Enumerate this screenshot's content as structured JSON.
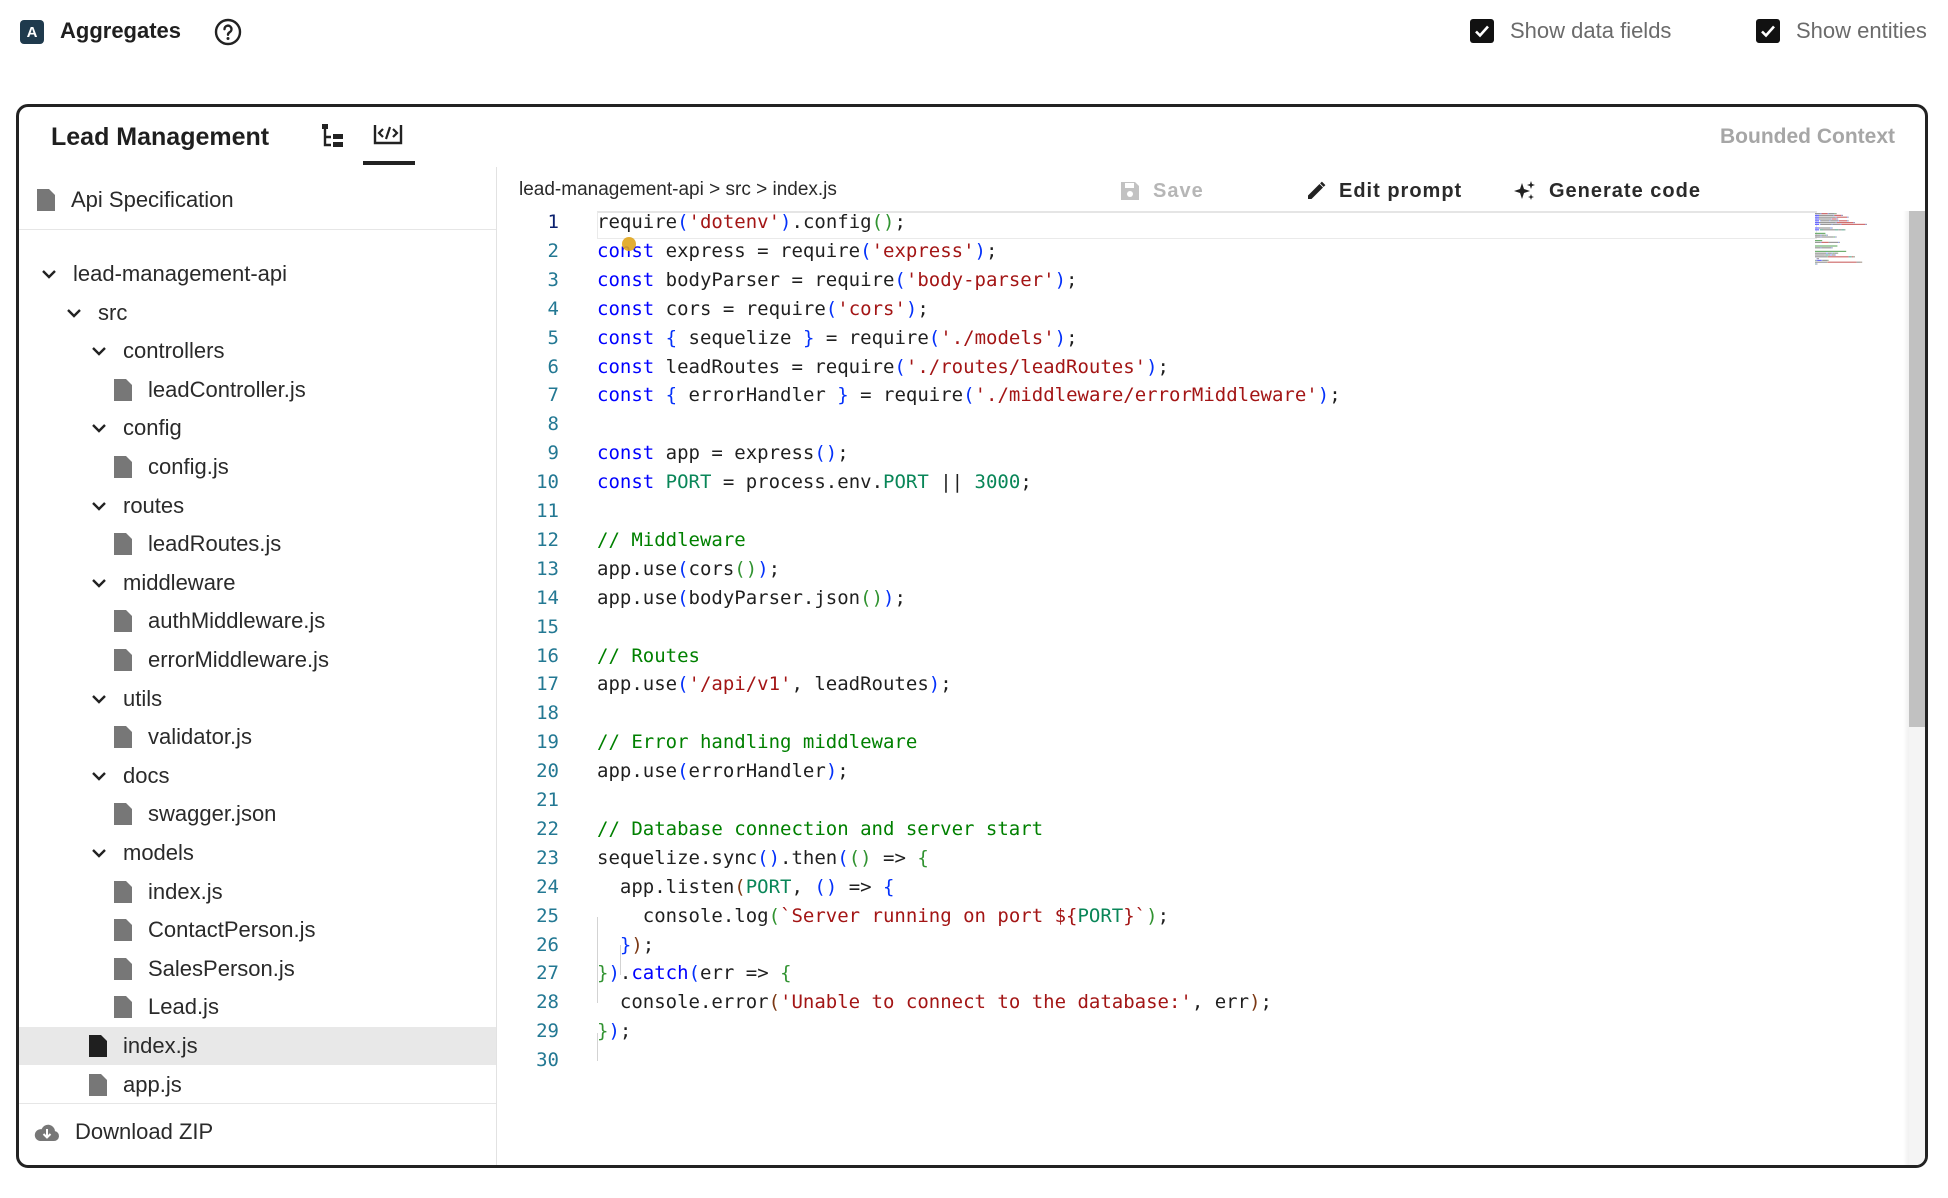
{
  "app": {
    "title": "Aggregates",
    "logo_letter": "A"
  },
  "toggles": [
    {
      "label": "Show data fields",
      "checked": true
    },
    {
      "label": "Show entities",
      "checked": true
    }
  ],
  "panel": {
    "title": "Lead Management",
    "context_label": "Bounded Context"
  },
  "sidebar": {
    "api_spec": "Api Specification",
    "tree": [
      {
        "label": "lead-management-api",
        "type": "folder"
      },
      {
        "label": "src",
        "type": "folder"
      },
      {
        "label": "controllers",
        "type": "folder"
      },
      {
        "label": "leadController.js",
        "type": "file"
      },
      {
        "label": "config",
        "type": "folder"
      },
      {
        "label": "config.js",
        "type": "file"
      },
      {
        "label": "routes",
        "type": "folder"
      },
      {
        "label": "leadRoutes.js",
        "type": "file"
      },
      {
        "label": "middleware",
        "type": "folder"
      },
      {
        "label": "authMiddleware.js",
        "type": "file"
      },
      {
        "label": "errorMiddleware.js",
        "type": "file"
      },
      {
        "label": "utils",
        "type": "folder"
      },
      {
        "label": "validator.js",
        "type": "file"
      },
      {
        "label": "docs",
        "type": "folder"
      },
      {
        "label": "swagger.json",
        "type": "file"
      },
      {
        "label": "models",
        "type": "folder"
      },
      {
        "label": "index.js",
        "type": "file"
      },
      {
        "label": "ContactPerson.js",
        "type": "file"
      },
      {
        "label": "SalesPerson.js",
        "type": "file"
      },
      {
        "label": "Lead.js",
        "type": "file"
      },
      {
        "label": "index.js",
        "type": "file",
        "selected": true
      },
      {
        "label": "app.js",
        "type": "file"
      }
    ],
    "download": "Download ZIP"
  },
  "editor": {
    "breadcrumb": "lead-management-api > src > index.js",
    "save": "Save",
    "edit_prompt": "Edit prompt",
    "generate_code": "Generate code",
    "active_line": 1,
    "lines": [
      [
        [
          "tok",
          "require"
        ],
        [
          "br1",
          "("
        ],
        [
          "str",
          "'dotenv'"
        ],
        [
          "br1",
          ")"
        ],
        [
          "tok",
          ".config"
        ],
        [
          "br2",
          "()"
        ],
        [
          "tok",
          ";"
        ]
      ],
      [
        [
          "kw",
          "const"
        ],
        [
          "tok",
          " express = require"
        ],
        [
          "br1",
          "("
        ],
        [
          "str",
          "'express'"
        ],
        [
          "br1",
          ")"
        ],
        [
          "tok",
          ";"
        ]
      ],
      [
        [
          "kw",
          "const"
        ],
        [
          "tok",
          " bodyParser = require"
        ],
        [
          "br1",
          "("
        ],
        [
          "str",
          "'body-parser'"
        ],
        [
          "br1",
          ")"
        ],
        [
          "tok",
          ";"
        ]
      ],
      [
        [
          "kw",
          "const"
        ],
        [
          "tok",
          " cors = require"
        ],
        [
          "br1",
          "("
        ],
        [
          "str",
          "'cors'"
        ],
        [
          "br1",
          ")"
        ],
        [
          "tok",
          ";"
        ]
      ],
      [
        [
          "kw",
          "const"
        ],
        [
          "tok",
          " "
        ],
        [
          "br1",
          "{"
        ],
        [
          "tok",
          " sequelize "
        ],
        [
          "br1",
          "}"
        ],
        [
          "tok",
          " = require"
        ],
        [
          "br1",
          "("
        ],
        [
          "str",
          "'./models'"
        ],
        [
          "br1",
          ")"
        ],
        [
          "tok",
          ";"
        ]
      ],
      [
        [
          "kw",
          "const"
        ],
        [
          "tok",
          " leadRoutes = require"
        ],
        [
          "br1",
          "("
        ],
        [
          "str",
          "'./routes/leadRoutes'"
        ],
        [
          "br1",
          ")"
        ],
        [
          "tok",
          ";"
        ]
      ],
      [
        [
          "kw",
          "const"
        ],
        [
          "tok",
          " "
        ],
        [
          "br1",
          "{"
        ],
        [
          "tok",
          " errorHandler "
        ],
        [
          "br1",
          "}"
        ],
        [
          "tok",
          " = require"
        ],
        [
          "br1",
          "("
        ],
        [
          "str",
          "'./middleware/errorMiddleware'"
        ],
        [
          "br1",
          ")"
        ],
        [
          "tok",
          ";"
        ]
      ],
      [],
      [
        [
          "kw",
          "const"
        ],
        [
          "tok",
          " app = express"
        ],
        [
          "br1",
          "()"
        ],
        [
          "tok",
          ";"
        ]
      ],
      [
        [
          "kw",
          "const"
        ],
        [
          "tok",
          " "
        ],
        [
          "num",
          "PORT"
        ],
        [
          "tok",
          " = process.env."
        ],
        [
          "num",
          "PORT"
        ],
        [
          "tok",
          " || "
        ],
        [
          "num",
          "3000"
        ],
        [
          "tok",
          ";"
        ]
      ],
      [],
      [
        [
          "cm",
          "// Middleware"
        ]
      ],
      [
        [
          "tok",
          "app.use"
        ],
        [
          "br1",
          "("
        ],
        [
          "tok",
          "cors"
        ],
        [
          "br2",
          "()"
        ],
        [
          "br1",
          ")"
        ],
        [
          "tok",
          ";"
        ]
      ],
      [
        [
          "tok",
          "app.use"
        ],
        [
          "br1",
          "("
        ],
        [
          "tok",
          "bodyParser.json"
        ],
        [
          "br2",
          "()"
        ],
        [
          "br1",
          ")"
        ],
        [
          "tok",
          ";"
        ]
      ],
      [],
      [
        [
          "cm",
          "// Routes"
        ]
      ],
      [
        [
          "tok",
          "app.use"
        ],
        [
          "br1",
          "("
        ],
        [
          "str",
          "'/api/v1'"
        ],
        [
          "tok",
          ", leadRoutes"
        ],
        [
          "br1",
          ")"
        ],
        [
          "tok",
          ";"
        ]
      ],
      [],
      [
        [
          "cm",
          "// Error handling middleware"
        ]
      ],
      [
        [
          "tok",
          "app.use"
        ],
        [
          "br1",
          "("
        ],
        [
          "tok",
          "errorHandler"
        ],
        [
          "br1",
          ")"
        ],
        [
          "tok",
          ";"
        ]
      ],
      [],
      [
        [
          "cm",
          "// Database connection and server start"
        ]
      ],
      [
        [
          "tok",
          "sequelize.sync"
        ],
        [
          "br1",
          "()"
        ],
        [
          "tok",
          ".then"
        ],
        [
          "br1",
          "("
        ],
        [
          "br2",
          "()"
        ],
        [
          "tok",
          " => "
        ],
        [
          "br2",
          "{"
        ]
      ],
      [
        [
          "tok",
          "  app.listen"
        ],
        [
          "br3",
          "("
        ],
        [
          "num",
          "PORT"
        ],
        [
          "tok",
          ", "
        ],
        [
          "br1",
          "()"
        ],
        [
          "tok",
          " => "
        ],
        [
          "br1",
          "{"
        ]
      ],
      [
        [
          "tok",
          "    console.log"
        ],
        [
          "br2",
          "("
        ],
        [
          "str",
          "`Server running on port ${"
        ],
        [
          "num",
          "PORT"
        ],
        [
          "str",
          "}`"
        ],
        [
          "br2",
          ")"
        ],
        [
          "tok",
          ";"
        ]
      ],
      [
        [
          "tok",
          "  "
        ],
        [
          "br1",
          "}"
        ],
        [
          "br3",
          ")"
        ],
        [
          "tok",
          ";"
        ]
      ],
      [
        [
          "br2",
          "}"
        ],
        [
          "br1",
          ")"
        ],
        [
          "tok",
          "."
        ],
        [
          "kw",
          "catch"
        ],
        [
          "br1",
          "("
        ],
        [
          "tok",
          "err => "
        ],
        [
          "br2",
          "{"
        ]
      ],
      [
        [
          "tok",
          "  console.error"
        ],
        [
          "br3",
          "("
        ],
        [
          "str",
          "'Unable to connect to the database:'"
        ],
        [
          "tok",
          ", err"
        ],
        [
          "br3",
          ")"
        ],
        [
          "tok",
          ";"
        ]
      ],
      [
        [
          "br2",
          "}"
        ],
        [
          "br1",
          ")"
        ],
        [
          "tok",
          ";"
        ]
      ],
      []
    ]
  }
}
